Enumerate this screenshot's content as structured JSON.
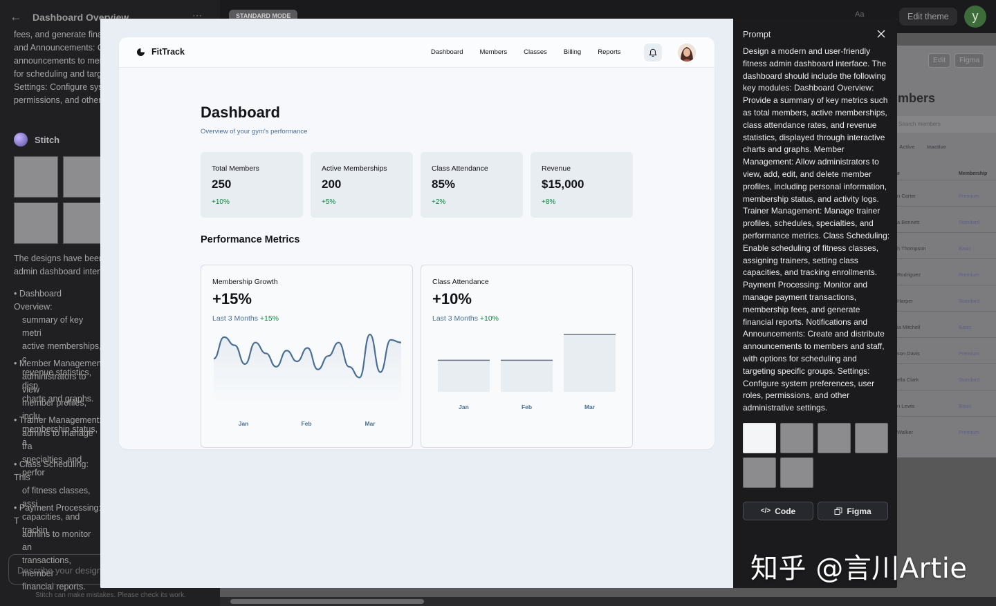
{
  "background_app": {
    "title": "Dashboard Overview",
    "mode_badge": "STANDARD MODE",
    "left_text_lines": [
      "fees, and generate finan",
      "and Announcements: Cr",
      "announcements to mem",
      "for scheduling and targe",
      "Settings: Configure syst",
      "permissions, and other a"
    ],
    "stitch_label": "Stitch",
    "summary_lines": [
      "The designs have been c",
      "admin dashboard interf"
    ],
    "bullets": [
      [
        "Dashboard Overview:",
        "summary of key metri",
        "active memberships, c",
        "revenue statistics, disp",
        "charts and graphs."
      ],
      [
        "Member Managemen",
        "administrators to view",
        "member profiles, inclu",
        "membership status, a"
      ],
      [
        "Trainer Management:",
        "admins to manage tra",
        "specialties, and perfor"
      ],
      [
        "Class Scheduling: This",
        "of fitness classes, assi",
        "capacities, and trackin"
      ],
      [
        "Payment Processing: T",
        "admins to monitor an",
        "transactions, member",
        "financial reports."
      ]
    ],
    "input_placeholder": "Describe your design",
    "disclaimer": "Stitch can make mistakes. Please check its work.",
    "aa_label": "Aa",
    "edit_theme": "Edit theme",
    "user_initial": "y",
    "edit_label": "Edit",
    "figma_label": "Figma",
    "members_title": "mbers",
    "search_placeholder": "Search members",
    "filters": [
      "Active",
      "Inactive"
    ],
    "col_name": "e",
    "col_membership": "Membership",
    "rows": [
      {
        "name": "n Carter",
        "membership": "Premium"
      },
      {
        "name": "a Bennett",
        "membership": "Standard"
      },
      {
        "name": "h Thompson",
        "membership": "Basic"
      },
      {
        "name": "Rodriguez",
        "membership": "Premium"
      },
      {
        "name": "Harper",
        "membership": "Standard"
      },
      {
        "name": "ia Mitchell",
        "membership": "Basic"
      },
      {
        "name": "son Davis",
        "membership": "Premium"
      },
      {
        "name": "ella Clark",
        "membership": "Standard"
      },
      {
        "name": "n Lewis",
        "membership": "Basic"
      },
      {
        "name": "Walker",
        "membership": "Premium"
      }
    ]
  },
  "app": {
    "brand": "FitTrack",
    "nav": [
      "Dashboard",
      "Members",
      "Classes",
      "Billing",
      "Reports"
    ],
    "icons": {
      "bell": "bell-icon",
      "avatar": "user-avatar"
    },
    "page_title": "Dashboard",
    "page_subtitle": "Overview of your gym's performance",
    "stats": [
      {
        "label": "Total Members",
        "value": "250",
        "change": "+10%"
      },
      {
        "label": "Active Memberships",
        "value": "200",
        "change": "+5%"
      },
      {
        "label": "Class Attendance",
        "value": "85%",
        "change": "+2%"
      },
      {
        "label": "Revenue",
        "value": "$15,000",
        "change": "+8%"
      }
    ],
    "section_title": "Performance Metrics",
    "charts": [
      {
        "label": "Membership Growth",
        "value": "+15%",
        "sub_prefix": "Last 3 Months",
        "sub_change": "+15%"
      },
      {
        "label": "Class Attendance",
        "value": "+10%",
        "sub_prefix": "Last 3 Months",
        "sub_change": "+10%"
      }
    ],
    "colors": {
      "accent": "#4a6f95",
      "positive": "#07883b",
      "card": "#e8edf2",
      "text": "#121417"
    }
  },
  "chart_data": [
    {
      "type": "line",
      "title": "Membership Growth",
      "x": [
        "Jan",
        "Feb",
        "Mar"
      ],
      "series": [
        {
          "values": [
            0.55,
            0.95,
            0.8,
            0.45,
            0.85,
            0.65,
            0.4,
            0.7,
            0.5,
            0.75,
            0.35,
            0.6,
            0.85,
            0.4,
            0.2,
            1.0,
            0.3,
            0.9,
            0.85
          ]
        }
      ],
      "grid": false,
      "legend": "none",
      "ylabel": "",
      "xlabel": ""
    },
    {
      "type": "bar",
      "title": "Class Attendance",
      "categories": [
        "Jan",
        "Feb",
        "Mar"
      ],
      "values": [
        0.55,
        0.55,
        1.0
      ],
      "ylim": [
        0,
        1
      ],
      "ylabel": "",
      "xlabel": ""
    }
  ],
  "prompt_panel": {
    "heading": "Prompt",
    "text": "Design a modern and user-friendly fitness admin dashboard interface. The dashboard should include the following key modules: Dashboard Overview: Provide a summary of key metrics such as total members, active memberships, class attendance rates, and revenue statistics, displayed through interactive charts and graphs. Member Management: Allow administrators to view, add, edit, and delete member profiles, including personal information, membership status, and activity logs. Trainer Management: Manage trainer profiles, schedules, specialties, and performance metrics. Class Scheduling: Enable scheduling of fitness classes, assigning trainers, setting class capacities, and tracking enrollments. Payment Processing: Monitor and manage payment transactions, membership fees, and generate financial reports. Notifications and Announcements: Create and distribute announcements to members and staff, with options for scheduling and targeting specific groups. Settings: Configure system preferences, user roles, permissions, and other administrative settings.",
    "code_label": "Code",
    "figma_label": "Figma"
  },
  "watermark": "知乎 @言川Artie"
}
